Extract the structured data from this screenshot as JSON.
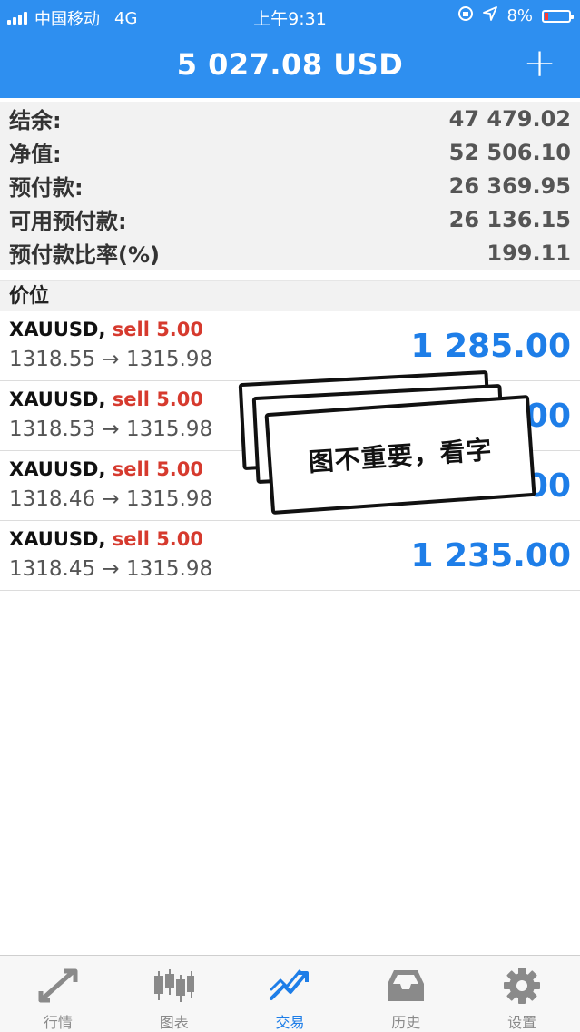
{
  "status_bar": {
    "carrier": "中国移动",
    "network": "4G",
    "time": "上午9:31",
    "battery": "8%"
  },
  "header": {
    "title": "5 027.08 USD",
    "add_label": "+"
  },
  "summary": [
    {
      "label": "结余:",
      "value": "47 479.02"
    },
    {
      "label": "净值:",
      "value": "52 506.10"
    },
    {
      "label": "预付款:",
      "value": "26 369.95"
    },
    {
      "label": "可用预付款:",
      "value": "26 136.15"
    },
    {
      "label": "预付款比率(%)",
      "value": "199.11"
    }
  ],
  "section_header": "价位",
  "positions": [
    {
      "symbol": "XAUUSD,",
      "side": "sell 5.00",
      "prices": "1318.55 → 1315.98",
      "profit": "1 285.00"
    },
    {
      "symbol": "XAUUSD,",
      "side": "sell 5.00",
      "prices": "1318.53 → 1315.98",
      "profit": "00"
    },
    {
      "symbol": "XAUUSD,",
      "side": "sell 5.00",
      "prices": "1318.46 → 1315.98",
      "profit": "00"
    },
    {
      "symbol": "XAUUSD,",
      "side": "sell 5.00",
      "prices": "1318.45 → 1315.98",
      "profit": "1 235.00"
    }
  ],
  "overlay_text": "图不重要，看字",
  "tabs": [
    {
      "label": "行情",
      "icon": "quotes-icon",
      "active": false
    },
    {
      "label": "图表",
      "icon": "chart-icon",
      "active": false
    },
    {
      "label": "交易",
      "icon": "trade-icon",
      "active": true
    },
    {
      "label": "历史",
      "icon": "history-icon",
      "active": false
    },
    {
      "label": "设置",
      "icon": "settings-icon",
      "active": false
    }
  ],
  "colors": {
    "header_bg": "#2e8ff0",
    "sell": "#d63a2e",
    "profit": "#1e7ee8",
    "tab_active": "#1e7ee8"
  }
}
